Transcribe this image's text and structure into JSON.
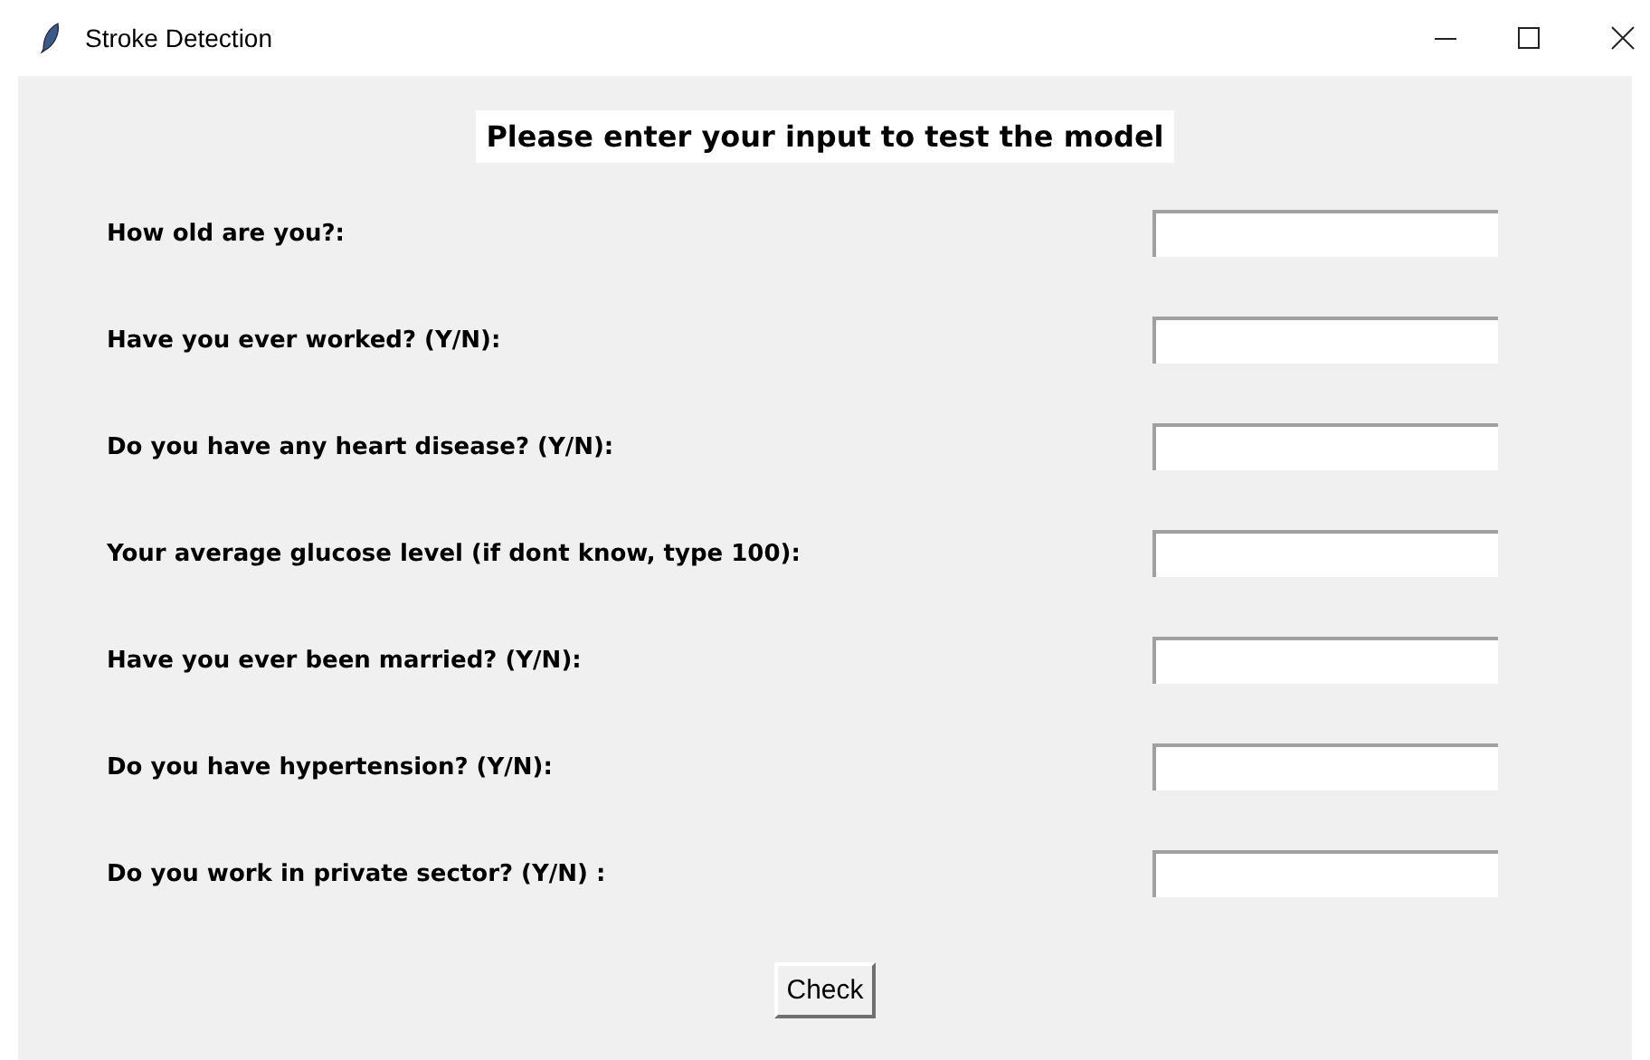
{
  "window": {
    "title": "Stroke Detection"
  },
  "heading": "Please enter your input to test the model",
  "fields": [
    {
      "label": "How old are you?:"
    },
    {
      "label": "Have you ever worked? (Y/N):"
    },
    {
      "label": "Do you have any heart disease? (Y/N):"
    },
    {
      "label": "Your average glucose level (if dont know, type 100):"
    },
    {
      "label": "Have you ever been married? (Y/N):"
    },
    {
      "label": "Do you have hypertension? (Y/N):"
    },
    {
      "label": "Do you work in private sector? (Y/N) :"
    }
  ],
  "button": "Check"
}
